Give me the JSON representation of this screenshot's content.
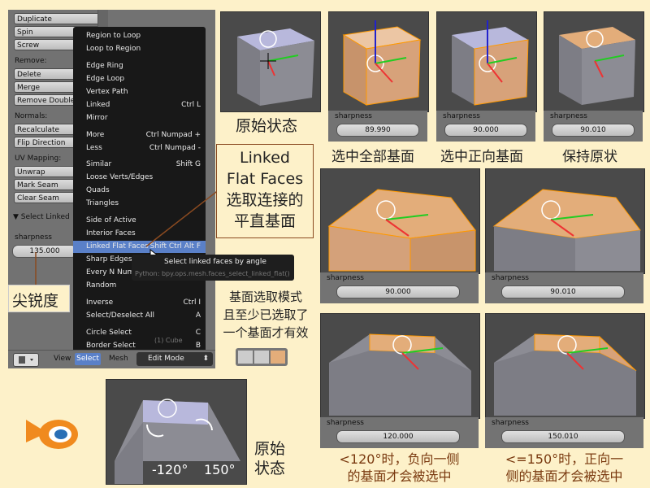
{
  "panel": {
    "buttons": [
      "Duplicate",
      "Spin",
      "Screw",
      "Delete",
      "Merge",
      "Remove Doubles",
      "Recalculate",
      "Flip Direction",
      "Unwrap",
      "Mark Seam",
      "Clear Seam"
    ],
    "labels": [
      "Remove:",
      "Normals:",
      "UV Mapping:"
    ],
    "section": "▼ Select Linked",
    "sharpness_label": "sharpness",
    "sharpness_value": "135.000"
  },
  "menu": [
    {
      "label": "Region to Loop",
      "shortcut": ""
    },
    {
      "label": "Loop to Region",
      "shortcut": ""
    },
    {
      "label": "Edge Ring",
      "shortcut": ""
    },
    {
      "label": "Edge Loop",
      "shortcut": ""
    },
    {
      "label": "Vertex Path",
      "shortcut": ""
    },
    {
      "label": "Linked",
      "shortcut": "Ctrl L"
    },
    {
      "label": "Mirror",
      "shortcut": ""
    },
    {
      "label": "More",
      "shortcut": "Ctrl Numpad +"
    },
    {
      "label": "Less",
      "shortcut": "Ctrl Numpad -"
    },
    {
      "label": "Similar",
      "shortcut": "Shift G"
    },
    {
      "label": "Loose Verts/Edges",
      "shortcut": ""
    },
    {
      "label": "Quads",
      "shortcut": ""
    },
    {
      "label": "Triangles",
      "shortcut": ""
    },
    {
      "label": "Side of Active",
      "shortcut": ""
    },
    {
      "label": "Interior Faces",
      "shortcut": ""
    },
    {
      "label": "Linked Flat Faces",
      "shortcut": "Shift Ctrl Alt F"
    },
    {
      "label": "Sharp Edges",
      "shortcut": ""
    },
    {
      "label": "Every N Num",
      "shortcut": ""
    },
    {
      "label": "Random",
      "shortcut": ""
    },
    {
      "label": "Inverse",
      "shortcut": "Ctrl I"
    },
    {
      "label": "Select/Deselect All",
      "shortcut": "A"
    },
    {
      "label": "Circle Select",
      "shortcut": "C"
    },
    {
      "label": "Border Select",
      "shortcut": "B"
    }
  ],
  "tooltip": {
    "title": "Select linked faces by angle",
    "python": "Python: bpy.ops.mesh.faces_select_linked_flat()",
    "cube": "(1) Cube"
  },
  "header": {
    "view": "View",
    "select": "Select",
    "mesh": "Mesh",
    "mode": "Edit Mode"
  },
  "annotations": {
    "title1": "Linked",
    "title2": "Flat Faces",
    "title3": "选取连接的",
    "title4": "平直基面",
    "sharpness_cn": "尖锐度",
    "mode_note1": "基面选取模式",
    "mode_note2": "且至少已选取了",
    "mode_note3": "一个基面才有效"
  },
  "views": {
    "orig_caption": "原始状态",
    "fields": [
      {
        "label": "sharpness",
        "value": "89.990",
        "caption": "选中全部基面"
      },
      {
        "label": "sharpness",
        "value": "90.000",
        "caption": "选中正向基面"
      },
      {
        "label": "sharpness",
        "value": "90.010",
        "caption": "保持原状"
      },
      {
        "label": "sharpness",
        "value": "90.000"
      },
      {
        "label": "sharpness",
        "value": "90.010"
      },
      {
        "label": "sharpness",
        "value": "120.000"
      },
      {
        "label": "sharpness",
        "value": "150.010"
      }
    ],
    "caption_120a": "<120°时，负向一侧",
    "caption_120b": "的基面才会被选中",
    "caption_150a": "<=150°时，正向一",
    "caption_150b": "侧的基面才会被选中",
    "bottom_caption1": "原始",
    "bottom_caption2": "状态",
    "angle_neg": "-120°",
    "angle_pos": "150°"
  },
  "colors": {
    "background": "#fdf1c9",
    "highlight": "#5a80c8",
    "face_selected": "#e3ad7a",
    "annotation_line": "#8a4a20"
  }
}
